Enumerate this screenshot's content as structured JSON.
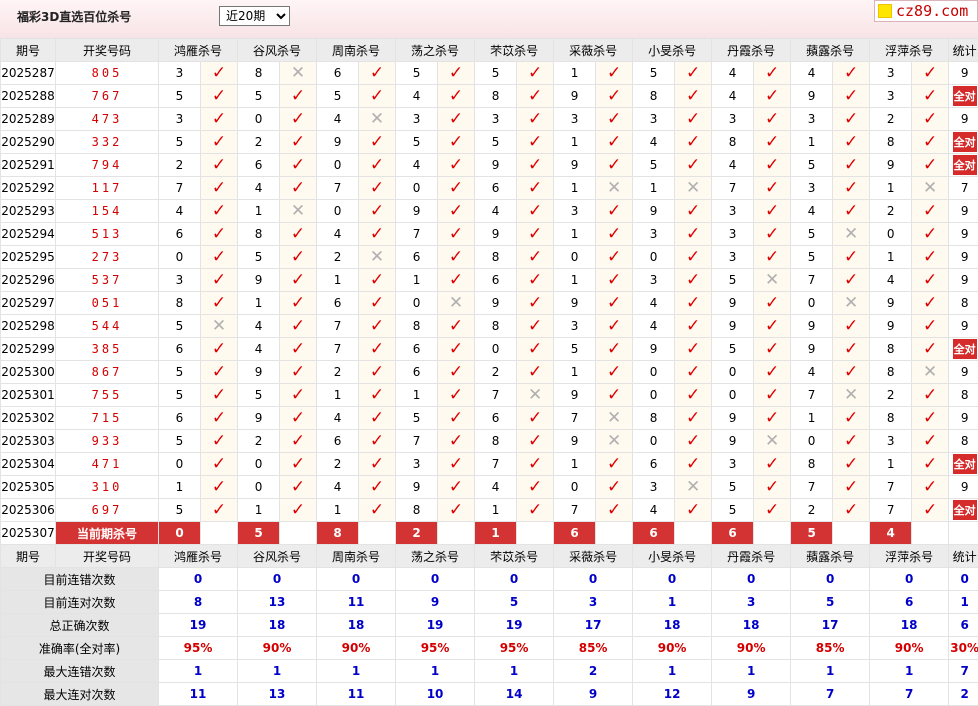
{
  "header": {
    "title": "福彩3D直选百位杀号",
    "period_select": "近20期",
    "logo_text": "cz89.com"
  },
  "columns": {
    "issue": "期号",
    "draw": "开奖号码",
    "stat": "统计",
    "experts": [
      "鸿雁杀号",
      "谷风杀号",
      "周南杀号",
      "荡之杀号",
      "芣苡杀号",
      "采薇杀号",
      "小旻杀号",
      "丹霞杀号",
      "蘋露杀号",
      "浮萍杀号"
    ]
  },
  "rows": [
    {
      "issue": "2025287",
      "draw": "805",
      "picks": [
        [
          3,
          1
        ],
        [
          8,
          0
        ],
        [
          6,
          1
        ],
        [
          5,
          1
        ],
        [
          5,
          1
        ],
        [
          1,
          1
        ],
        [
          5,
          1
        ],
        [
          4,
          1
        ],
        [
          4,
          1
        ],
        [
          3,
          1
        ]
      ],
      "stat": "9"
    },
    {
      "issue": "2025288",
      "draw": "767",
      "picks": [
        [
          5,
          1
        ],
        [
          5,
          1
        ],
        [
          5,
          1
        ],
        [
          4,
          1
        ],
        [
          8,
          1
        ],
        [
          9,
          1
        ],
        [
          8,
          1
        ],
        [
          4,
          1
        ],
        [
          9,
          1
        ],
        [
          3,
          1
        ]
      ],
      "stat": "全对"
    },
    {
      "issue": "2025289",
      "draw": "473",
      "picks": [
        [
          3,
          1
        ],
        [
          0,
          1
        ],
        [
          4,
          0
        ],
        [
          3,
          1
        ],
        [
          3,
          1
        ],
        [
          3,
          1
        ],
        [
          3,
          1
        ],
        [
          3,
          1
        ],
        [
          3,
          1
        ],
        [
          2,
          1
        ]
      ],
      "stat": "9"
    },
    {
      "issue": "2025290",
      "draw": "332",
      "picks": [
        [
          5,
          1
        ],
        [
          2,
          1
        ],
        [
          9,
          1
        ],
        [
          5,
          1
        ],
        [
          5,
          1
        ],
        [
          1,
          1
        ],
        [
          4,
          1
        ],
        [
          8,
          1
        ],
        [
          1,
          1
        ],
        [
          8,
          1
        ]
      ],
      "stat": "全对"
    },
    {
      "issue": "2025291",
      "draw": "794",
      "picks": [
        [
          2,
          1
        ],
        [
          6,
          1
        ],
        [
          0,
          1
        ],
        [
          4,
          1
        ],
        [
          9,
          1
        ],
        [
          9,
          1
        ],
        [
          5,
          1
        ],
        [
          4,
          1
        ],
        [
          5,
          1
        ],
        [
          9,
          1
        ]
      ],
      "stat": "全对"
    },
    {
      "issue": "2025292",
      "draw": "117",
      "picks": [
        [
          7,
          1
        ],
        [
          4,
          1
        ],
        [
          7,
          1
        ],
        [
          0,
          1
        ],
        [
          6,
          1
        ],
        [
          1,
          0
        ],
        [
          1,
          0
        ],
        [
          7,
          1
        ],
        [
          3,
          1
        ],
        [
          1,
          0
        ]
      ],
      "stat": "7"
    },
    {
      "issue": "2025293",
      "draw": "154",
      "picks": [
        [
          4,
          1
        ],
        [
          1,
          0
        ],
        [
          0,
          1
        ],
        [
          9,
          1
        ],
        [
          4,
          1
        ],
        [
          3,
          1
        ],
        [
          9,
          1
        ],
        [
          3,
          1
        ],
        [
          4,
          1
        ],
        [
          2,
          1
        ]
      ],
      "stat": "9"
    },
    {
      "issue": "2025294",
      "draw": "513",
      "picks": [
        [
          6,
          1
        ],
        [
          8,
          1
        ],
        [
          4,
          1
        ],
        [
          7,
          1
        ],
        [
          9,
          1
        ],
        [
          1,
          1
        ],
        [
          3,
          1
        ],
        [
          3,
          1
        ],
        [
          5,
          0
        ],
        [
          0,
          1
        ]
      ],
      "stat": "9"
    },
    {
      "issue": "2025295",
      "draw": "273",
      "picks": [
        [
          0,
          1
        ],
        [
          5,
          1
        ],
        [
          2,
          0
        ],
        [
          6,
          1
        ],
        [
          8,
          1
        ],
        [
          0,
          1
        ],
        [
          0,
          1
        ],
        [
          3,
          1
        ],
        [
          5,
          1
        ],
        [
          1,
          1
        ]
      ],
      "stat": "9"
    },
    {
      "issue": "2025296",
      "draw": "537",
      "picks": [
        [
          3,
          1
        ],
        [
          9,
          1
        ],
        [
          1,
          1
        ],
        [
          1,
          1
        ],
        [
          6,
          1
        ],
        [
          1,
          1
        ],
        [
          3,
          1
        ],
        [
          5,
          0
        ],
        [
          7,
          1
        ],
        [
          4,
          1
        ]
      ],
      "stat": "9"
    },
    {
      "issue": "2025297",
      "draw": "051",
      "picks": [
        [
          8,
          1
        ],
        [
          1,
          1
        ],
        [
          6,
          1
        ],
        [
          0,
          0
        ],
        [
          9,
          1
        ],
        [
          9,
          1
        ],
        [
          4,
          1
        ],
        [
          9,
          1
        ],
        [
          0,
          0
        ],
        [
          9,
          1
        ]
      ],
      "stat": "8"
    },
    {
      "issue": "2025298",
      "draw": "544",
      "picks": [
        [
          5,
          0
        ],
        [
          4,
          1
        ],
        [
          7,
          1
        ],
        [
          8,
          1
        ],
        [
          8,
          1
        ],
        [
          3,
          1
        ],
        [
          4,
          1
        ],
        [
          9,
          1
        ],
        [
          9,
          1
        ],
        [
          9,
          1
        ]
      ],
      "stat": "9"
    },
    {
      "issue": "2025299",
      "draw": "385",
      "picks": [
        [
          6,
          1
        ],
        [
          4,
          1
        ],
        [
          7,
          1
        ],
        [
          6,
          1
        ],
        [
          0,
          1
        ],
        [
          5,
          1
        ],
        [
          9,
          1
        ],
        [
          5,
          1
        ],
        [
          9,
          1
        ],
        [
          8,
          1
        ]
      ],
      "stat": "全对"
    },
    {
      "issue": "2025300",
      "draw": "867",
      "picks": [
        [
          5,
          1
        ],
        [
          9,
          1
        ],
        [
          2,
          1
        ],
        [
          6,
          1
        ],
        [
          2,
          1
        ],
        [
          1,
          1
        ],
        [
          0,
          1
        ],
        [
          0,
          1
        ],
        [
          4,
          1
        ],
        [
          8,
          0
        ]
      ],
      "stat": "9"
    },
    {
      "issue": "2025301",
      "draw": "755",
      "picks": [
        [
          5,
          1
        ],
        [
          5,
          1
        ],
        [
          1,
          1
        ],
        [
          1,
          1
        ],
        [
          7,
          0
        ],
        [
          9,
          1
        ],
        [
          0,
          1
        ],
        [
          0,
          1
        ],
        [
          7,
          0
        ],
        [
          2,
          1
        ]
      ],
      "stat": "8"
    },
    {
      "issue": "2025302",
      "draw": "715",
      "picks": [
        [
          6,
          1
        ],
        [
          9,
          1
        ],
        [
          4,
          1
        ],
        [
          5,
          1
        ],
        [
          6,
          1
        ],
        [
          7,
          0
        ],
        [
          8,
          1
        ],
        [
          9,
          1
        ],
        [
          1,
          1
        ],
        [
          8,
          1
        ]
      ],
      "stat": "9"
    },
    {
      "issue": "2025303",
      "draw": "933",
      "picks": [
        [
          5,
          1
        ],
        [
          2,
          1
        ],
        [
          6,
          1
        ],
        [
          7,
          1
        ],
        [
          8,
          1
        ],
        [
          9,
          0
        ],
        [
          0,
          1
        ],
        [
          9,
          0
        ],
        [
          0,
          1
        ],
        [
          3,
          1
        ]
      ],
      "stat": "8"
    },
    {
      "issue": "2025304",
      "draw": "471",
      "picks": [
        [
          0,
          1
        ],
        [
          0,
          1
        ],
        [
          2,
          1
        ],
        [
          3,
          1
        ],
        [
          7,
          1
        ],
        [
          1,
          1
        ],
        [
          6,
          1
        ],
        [
          3,
          1
        ],
        [
          8,
          1
        ],
        [
          1,
          1
        ]
      ],
      "stat": "全对"
    },
    {
      "issue": "2025305",
      "draw": "310",
      "picks": [
        [
          1,
          1
        ],
        [
          0,
          1
        ],
        [
          4,
          1
        ],
        [
          9,
          1
        ],
        [
          4,
          1
        ],
        [
          0,
          1
        ],
        [
          3,
          0
        ],
        [
          5,
          1
        ],
        [
          7,
          1
        ],
        [
          7,
          1
        ]
      ],
      "stat": "9"
    },
    {
      "issue": "2025306",
      "draw": "697",
      "picks": [
        [
          5,
          1
        ],
        [
          1,
          1
        ],
        [
          1,
          1
        ],
        [
          8,
          1
        ],
        [
          1,
          1
        ],
        [
          7,
          1
        ],
        [
          4,
          1
        ],
        [
          5,
          1
        ],
        [
          2,
          1
        ],
        [
          7,
          1
        ]
      ],
      "stat": "全对"
    }
  ],
  "current": {
    "issue": "2025307",
    "label": "当前期杀号",
    "values": [
      "0",
      "5",
      "8",
      "2",
      "1",
      "6",
      "6",
      "6",
      "5",
      "4"
    ]
  },
  "stats": [
    {
      "label": "目前连错次数",
      "values": [
        "0",
        "0",
        "0",
        "0",
        "0",
        "0",
        "0",
        "0",
        "0",
        "0"
      ],
      "total": "0",
      "color": "blue"
    },
    {
      "label": "目前连对次数",
      "values": [
        "8",
        "13",
        "11",
        "9",
        "5",
        "3",
        "1",
        "3",
        "5",
        "6"
      ],
      "total": "1",
      "color": "blue"
    },
    {
      "label": "总正确次数",
      "values": [
        "19",
        "18",
        "18",
        "19",
        "19",
        "17",
        "18",
        "18",
        "17",
        "18"
      ],
      "total": "6",
      "color": "blue"
    },
    {
      "label": "准确率(全对率)",
      "values": [
        "95%",
        "90%",
        "90%",
        "95%",
        "95%",
        "85%",
        "90%",
        "90%",
        "85%",
        "90%"
      ],
      "total": "30%",
      "color": "red"
    },
    {
      "label": "最大连错次数",
      "values": [
        "1",
        "1",
        "1",
        "1",
        "1",
        "2",
        "1",
        "1",
        "1",
        "1"
      ],
      "total": "7",
      "color": "blue"
    },
    {
      "label": "最大连对次数",
      "values": [
        "11",
        "13",
        "11",
        "10",
        "14",
        "9",
        "12",
        "9",
        "7",
        "7"
      ],
      "total": "2",
      "color": "blue"
    }
  ]
}
